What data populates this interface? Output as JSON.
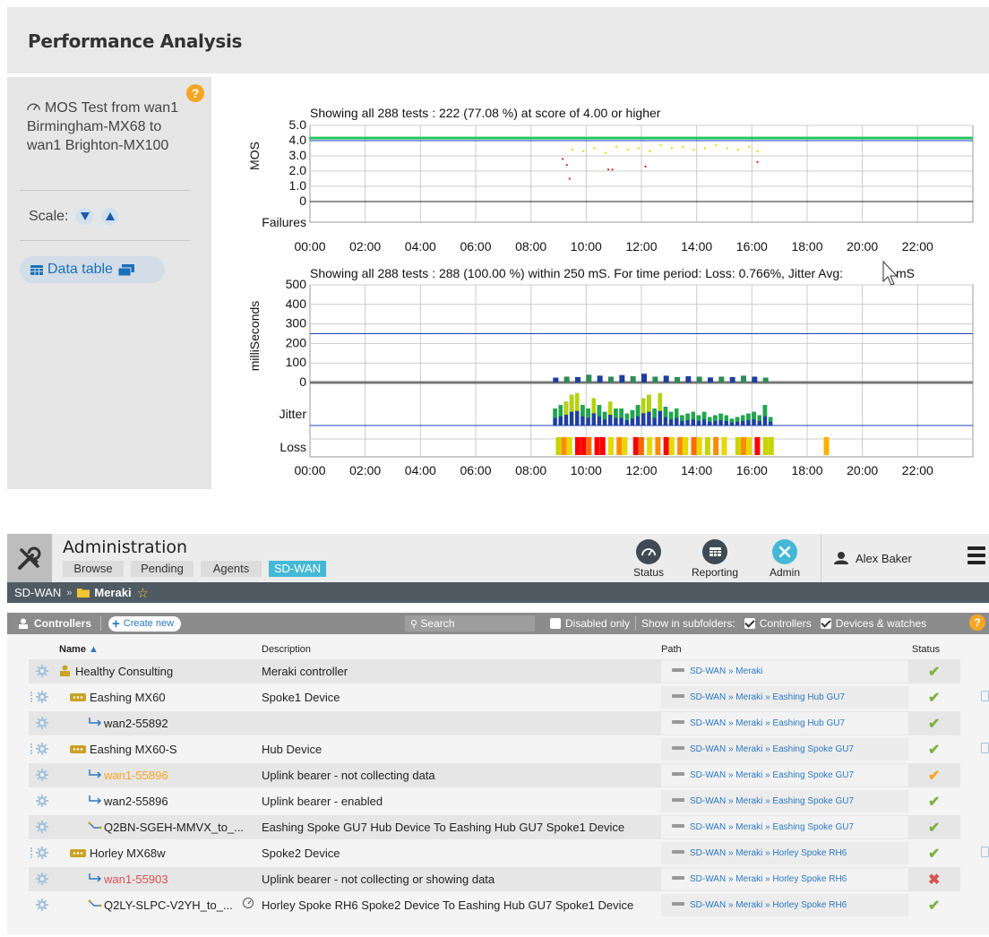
{
  "performance": {
    "title": "Performance Analysis",
    "panel": {
      "mos_title": "MOS Test from wan1 Birmingham-MX68 to wan1 Brighton-MX100",
      "scale_label": "Scale:",
      "data_table_label": "Data table",
      "help": "?"
    }
  },
  "chart_data": [
    {
      "type": "scatter",
      "title": "Showing all 288 tests : 222 (77.08 %) at score of 4.00 or higher",
      "ylabel": "MOS",
      "ylim": [
        0,
        5
      ],
      "yticks": [
        "5.0",
        "4.0",
        "3.0",
        "2.0",
        "1.0",
        "0"
      ],
      "threshold": 4.0,
      "extra_rows": [
        "Failures"
      ],
      "x_ticks": [
        "00:00",
        "02:00",
        "04:00",
        "06:00",
        "08:00",
        "10:00",
        "12:00",
        "14:00",
        "16:00",
        "18:00",
        "20:00",
        "22:00"
      ],
      "series": [
        {
          "color": "#22c55e",
          "x": [
            0.0,
            1.0,
            2.0,
            3.0,
            4.0,
            5.0,
            6.0,
            7.0,
            8.0,
            8.8,
            9.8,
            10.2,
            10.6,
            11.0,
            11.4,
            11.8,
            12.2,
            12.6,
            13.0,
            13.4,
            13.8,
            14.2,
            14.6,
            15.0,
            15.4,
            15.8,
            16.3,
            17.0,
            18.0,
            19.0,
            20.0,
            21.0,
            22.0,
            23.0,
            23.9
          ],
          "y": [
            4.15,
            4.15,
            4.15,
            4.15,
            4.15,
            4.15,
            4.15,
            4.15,
            4.15,
            4.15,
            4.15,
            4.15,
            4.15,
            4.15,
            4.15,
            4.15,
            4.15,
            4.15,
            4.15,
            4.15,
            4.15,
            4.15,
            4.15,
            4.15,
            4.15,
            4.15,
            4.15,
            4.15,
            4.15,
            4.15,
            4.15,
            4.15,
            4.15,
            4.15,
            4.15
          ]
        },
        {
          "color": "#e6d800",
          "x": [
            9.5,
            9.9,
            10.3,
            10.7,
            11.1,
            11.5,
            11.9,
            12.3,
            12.7,
            13.1,
            13.5,
            13.9,
            14.3,
            14.7,
            15.1,
            15.5,
            15.9,
            16.2
          ],
          "y": [
            3.4,
            3.3,
            3.5,
            3.2,
            3.6,
            3.4,
            3.5,
            3.3,
            3.7,
            3.5,
            3.6,
            3.4,
            3.5,
            3.7,
            3.5,
            3.4,
            3.6,
            3.3
          ]
        },
        {
          "color": "#d62728",
          "x": [
            9.15,
            9.3,
            9.4,
            10.8,
            10.95,
            12.15,
            16.2
          ],
          "y": [
            2.8,
            2.4,
            1.5,
            2.1,
            2.1,
            2.3,
            2.6
          ]
        }
      ]
    },
    {
      "type": "bar",
      "title": "Showing all 288 tests : 288 (100.00 %) within 250 mS. For time period: Loss: 0.766%, Jitter Avg:",
      "title_tail": "mS",
      "ylabel": "milliSeconds",
      "ylim": [
        0,
        500
      ],
      "yticks": [
        "500",
        "400",
        "300",
        "200",
        "100",
        "0"
      ],
      "threshold": 250,
      "extra_rows": [
        "Jitter",
        "Loss"
      ],
      "x_ticks": [
        "00:00",
        "02:00",
        "04:00",
        "06:00",
        "08:00",
        "10:00",
        "12:00",
        "14:00",
        "16:00",
        "18:00",
        "20:00",
        "22:00"
      ],
      "latency_x": [
        8.8,
        9.2,
        9.6,
        10.0,
        10.4,
        10.8,
        11.2,
        11.6,
        12.0,
        12.4,
        12.8,
        13.2,
        13.6,
        14.0,
        14.4,
        14.8,
        15.2,
        15.6,
        16.0,
        16.4
      ],
      "latency_values": [
        25,
        30,
        28,
        40,
        35,
        30,
        38,
        32,
        45,
        30,
        35,
        28,
        32,
        30,
        26,
        30,
        28,
        35,
        30,
        25
      ],
      "jitter_x": [
        8.8,
        9.0,
        9.2,
        9.4,
        9.6,
        9.8,
        10.0,
        10.2,
        10.4,
        10.6,
        10.8,
        11.0,
        11.2,
        11.4,
        11.6,
        11.8,
        12.0,
        12.2,
        12.4,
        12.6,
        12.8,
        13.0,
        13.2,
        13.4,
        13.6,
        13.8,
        14.0,
        14.2,
        14.4,
        14.6,
        14.8,
        15.0,
        15.2,
        15.4,
        15.6,
        15.8,
        16.0,
        16.2,
        16.4,
        16.6
      ],
      "jitter_values": [
        0.5,
        0.6,
        0.7,
        0.9,
        0.95,
        0.6,
        0.5,
        0.8,
        0.6,
        0.4,
        0.7,
        0.5,
        0.5,
        0.35,
        0.45,
        0.6,
        0.8,
        0.9,
        0.5,
        0.95,
        0.55,
        0.4,
        0.5,
        0.3,
        0.35,
        0.4,
        0.3,
        0.4,
        0.25,
        0.3,
        0.35,
        0.3,
        0.2,
        0.25,
        0.3,
        0.35,
        0.4,
        0.3,
        0.6,
        0.25
      ],
      "loss_segments": [
        {
          "x": 8.9,
          "color": "#c8d400"
        },
        {
          "x": 9.1,
          "color": "#ff8c00"
        },
        {
          "x": 9.3,
          "color": "#e6d800"
        },
        {
          "x": 9.6,
          "color": "#ff0000"
        },
        {
          "x": 9.8,
          "color": "#ff0000"
        },
        {
          "x": 10.0,
          "color": "#ff6a00"
        },
        {
          "x": 10.3,
          "color": "#ff0000"
        },
        {
          "x": 10.5,
          "color": "#ff0000"
        },
        {
          "x": 10.8,
          "color": "#e6d800"
        },
        {
          "x": 11.1,
          "color": "#ff8c00"
        },
        {
          "x": 11.3,
          "color": "#e6d800"
        },
        {
          "x": 11.7,
          "color": "#ff0000"
        },
        {
          "x": 11.9,
          "color": "#ff6a00"
        },
        {
          "x": 12.2,
          "color": "#e6d800"
        },
        {
          "x": 12.5,
          "color": "#ff8c00"
        },
        {
          "x": 12.8,
          "color": "#ff0000"
        },
        {
          "x": 13.0,
          "color": "#e6d800"
        },
        {
          "x": 13.3,
          "color": "#ff8c00"
        },
        {
          "x": 13.5,
          "color": "#e6d800"
        },
        {
          "x": 13.8,
          "color": "#ff6a00"
        },
        {
          "x": 14.0,
          "color": "#e6d800"
        },
        {
          "x": 14.3,
          "color": "#c8d400"
        },
        {
          "x": 14.6,
          "color": "#ff8c00"
        },
        {
          "x": 14.9,
          "color": "#e6d800"
        },
        {
          "x": 15.4,
          "color": "#c8d400"
        },
        {
          "x": 15.6,
          "color": "#ff8c00"
        },
        {
          "x": 15.8,
          "color": "#e6d800"
        },
        {
          "x": 16.1,
          "color": "#ff0000"
        },
        {
          "x": 16.4,
          "color": "#c8d400"
        },
        {
          "x": 16.6,
          "color": "#c8d400"
        },
        {
          "x": 18.6,
          "color": "#ffb000"
        }
      ]
    }
  ],
  "admin": {
    "title": "Administration",
    "tabs": [
      "Browse",
      "Pending",
      "Agents",
      "SD-WAN"
    ],
    "active_tab": "SD-WAN",
    "nav": [
      {
        "label": "Status",
        "icon": "gauge-icon"
      },
      {
        "label": "Reporting",
        "icon": "table-icon"
      },
      {
        "label": "Admin",
        "icon": "tools-icon"
      }
    ],
    "user": "Alex Baker",
    "breadcrumb": {
      "root": "SD-WAN",
      "sep": "»",
      "folder": "Meraki",
      "star": "☆"
    },
    "toolbar": {
      "section": "Controllers",
      "create": "Create new",
      "search_placeholder": "Search",
      "disabled_only": "Disabled only",
      "show_in": "Show in subfolders:",
      "controllers": "Controllers",
      "devices": "Devices & watches",
      "help": "?"
    },
    "columns": {
      "name": "Name",
      "sort": "▲",
      "description": "Description",
      "path": "Path",
      "status": "Status"
    },
    "rows": [
      {
        "icon": "controller-icon",
        "name": "Healthy Consulting",
        "desc": "Meraki controller",
        "path": "SD-WAN » Meraki",
        "status": "ok"
      },
      {
        "icon": "device-icon",
        "name": "Eashing MX60",
        "desc": "Spoke1 Device",
        "path": "SD-WAN » Meraki » Eashing Hub GU7",
        "status": "ok"
      },
      {
        "icon": "link-icon",
        "name": "wan2-55892",
        "desc": "",
        "path": "SD-WAN » Meraki » Eashing Hub GU7",
        "status": "ok"
      },
      {
        "icon": "device-icon",
        "name": "Eashing MX60-S",
        "desc": "Hub Device",
        "path": "SD-WAN » Meraki » Eashing Spoke GU7",
        "status": "ok"
      },
      {
        "icon": "link-icon",
        "name": "wan1-55896",
        "desc": "Uplink bearer - not collecting data",
        "path": "SD-WAN » Meraki » Eashing Spoke GU7",
        "status": "warn"
      },
      {
        "icon": "link-icon",
        "name": "wan2-55896",
        "desc": "Uplink bearer - enabled",
        "path": "SD-WAN » Meraki » Eashing Spoke GU7",
        "status": "ok"
      },
      {
        "icon": "tunnel-icon",
        "name": "Q2BN-SGEH-MMVX_to_...",
        "desc": "Eashing Spoke GU7 Hub Device To Eashing Hub GU7 Spoke1 Device",
        "path": "SD-WAN » Meraki » Eashing Spoke GU7",
        "status": "ok"
      },
      {
        "icon": "device-icon",
        "name": "Horley MX68w",
        "desc": "Spoke2 Device",
        "path": "SD-WAN » Meraki » Horley Spoke RH6",
        "status": "ok"
      },
      {
        "icon": "link-icon",
        "name": "wan1-55903",
        "desc": "Uplink bearer - not collecting or showing data",
        "path": "SD-WAN » Meraki » Horley Spoke RH6",
        "status": "error"
      },
      {
        "icon": "tunnel-icon",
        "name": "Q2LY-SLPC-V2YH_to_...",
        "desc": "Horley Spoke RH6 Spoke2 Device To Eashing Hub GU7 Spoke1 Device",
        "path": "SD-WAN » Meraki » Horley Spoke RH6",
        "status": "ok"
      }
    ],
    "colors": {
      "ok": "#7cb342",
      "warn": "#f5a623",
      "error": "#d9534f",
      "accent": "#45b8d6",
      "link": "#2b79c2"
    }
  }
}
